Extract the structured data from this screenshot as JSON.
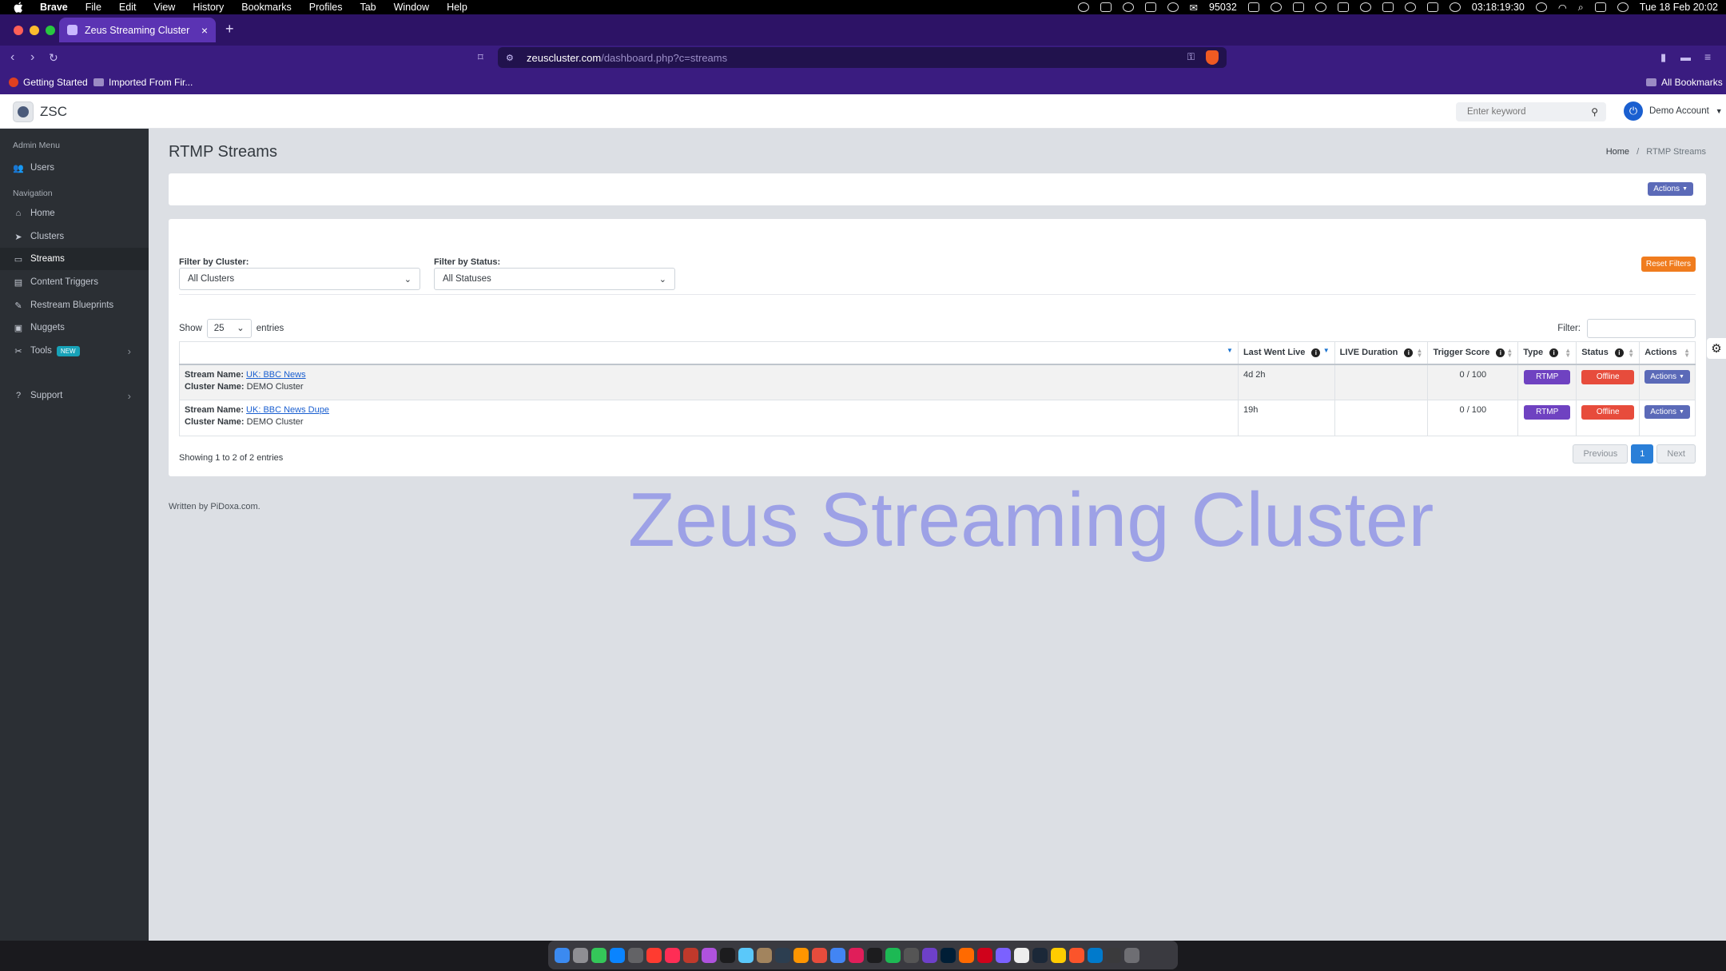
{
  "menubar": {
    "app": "Brave",
    "items": [
      "File",
      "Edit",
      "View",
      "History",
      "Bookmarks",
      "Profiles",
      "Tab",
      "Window",
      "Help"
    ],
    "counter": "95032",
    "timer": "03:18:19:30",
    "datetime": "Tue 18 Feb  20:02"
  },
  "browser": {
    "tab_title": "Zeus Streaming Cluster",
    "tab_close": "×",
    "new_tab": "+",
    "url_host": "zeuscluster.com",
    "url_path": "/dashboard.php?c=streams",
    "bookmarks": [
      "Getting Started",
      "Imported From Fir..."
    ],
    "all_bookmarks": "All Bookmarks"
  },
  "header": {
    "logo_text": "ZSC",
    "search_placeholder": "Enter keyword",
    "account": "Demo Account"
  },
  "sidebar": {
    "admin_heading": "Admin Menu",
    "admin_items": [
      {
        "label": "Users"
      }
    ],
    "nav_heading": "Navigation",
    "nav_items": [
      {
        "label": "Home"
      },
      {
        "label": "Clusters"
      },
      {
        "label": "Streams"
      },
      {
        "label": "Content Triggers"
      },
      {
        "label": "Restream Blueprints"
      },
      {
        "label": "Nuggets"
      },
      {
        "label": "Tools",
        "badge": "NEW"
      },
      {
        "label": "Support"
      }
    ]
  },
  "page": {
    "title": "RTMP Streams",
    "breadcrumb_home": "Home",
    "breadcrumb_sep": "/",
    "breadcrumb_current": "RTMP Streams",
    "top_actions": "Actions"
  },
  "filters": {
    "cluster_label": "Filter by Cluster:",
    "cluster_value": "All Clusters",
    "status_label": "Filter by Status:",
    "status_value": "All Statuses",
    "reset": "Reset Filters",
    "show_prefix": "Show",
    "show_value": "25",
    "show_suffix": "entries",
    "filter_label": "Filter:"
  },
  "table": {
    "headers": [
      "",
      "Last Went Live",
      "LIVE Duration",
      "Trigger Score",
      "Type",
      "Status",
      "Actions"
    ],
    "rows": [
      {
        "stream_label": "Stream Name:",
        "stream_name": "UK: BBC News",
        "cluster_label": "Cluster Name:",
        "cluster_name": "DEMO Cluster",
        "last_live": "4d 2h",
        "live_duration": "",
        "trigger_score": "0 / 100",
        "type": "RTMP",
        "status": "Offline",
        "actions": "Actions"
      },
      {
        "stream_label": "Stream Name:",
        "stream_name": "UK: BBC News Dupe",
        "cluster_label": "Cluster Name:",
        "cluster_name": "DEMO Cluster",
        "last_live": "19h",
        "live_duration": "",
        "trigger_score": "0 / 100",
        "type": "RTMP",
        "status": "Offline",
        "actions": "Actions"
      }
    ],
    "showing": "Showing 1 to 2 of 2 entries",
    "pager": {
      "prev": "Previous",
      "page": "1",
      "next": "Next"
    }
  },
  "footer": {
    "written": "Written by PiDoxa.com."
  },
  "watermark": "Zeus Streaming Cluster"
}
